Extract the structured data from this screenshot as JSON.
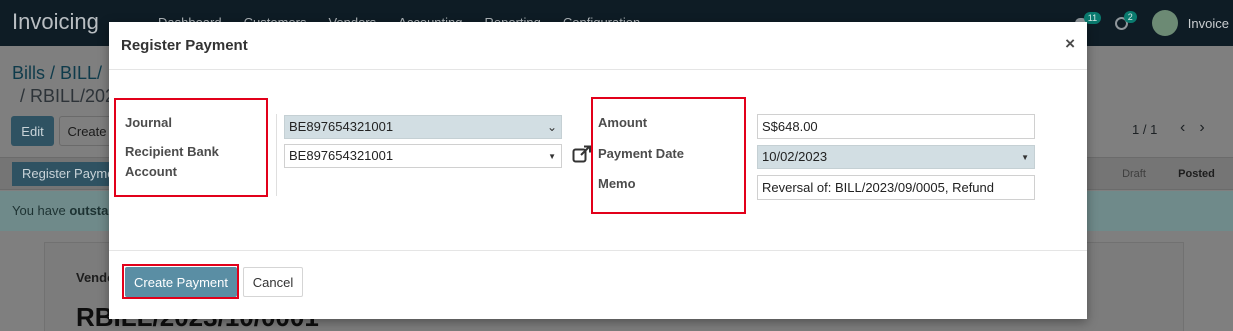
{
  "app": {
    "name": "Invoicing",
    "nav": [
      "Dashboard",
      "Customers",
      "Vendors",
      "Accounting",
      "Reporting",
      "Configuration"
    ],
    "chat_badge": "11",
    "activity_badge": "2",
    "user_name": "Invoice"
  },
  "background": {
    "breadcrumb_line1": "Bills / BILL/",
    "breadcrumb_line2": "/ RBILL/202",
    "edit_label": "Edit",
    "create_label": "Create",
    "pager": "1 / 1",
    "register_payment_label": "Register Payme",
    "stages": [
      "Draft",
      "Posted"
    ],
    "alert_prefix": "You have ",
    "alert_bold": "outstar",
    "vendor_label": "Vendo",
    "record_title": "RBILL/2023/10/0001"
  },
  "modal": {
    "title": "Register Payment",
    "fields": {
      "journal_label": "Journal",
      "journal_value": "BE897654321001",
      "recipient_bank_label_line1": "Recipient Bank",
      "recipient_bank_label_line2": "Account",
      "recipient_bank_value": "BE897654321001",
      "amount_label": "Amount",
      "amount_value": "S$648.00",
      "payment_date_label": "Payment Date",
      "payment_date_value": "10/02/2023",
      "memo_label": "Memo",
      "memo_value": "Reversal of: BILL/2023/09/0005, Refund"
    },
    "buttons": {
      "create_payment": "Create Payment",
      "cancel": "Cancel",
      "close": "×"
    }
  },
  "colors": {
    "primary": "#5a8ea4",
    "highlight": "#e2001a",
    "field_fill": "#d2dee3"
  }
}
